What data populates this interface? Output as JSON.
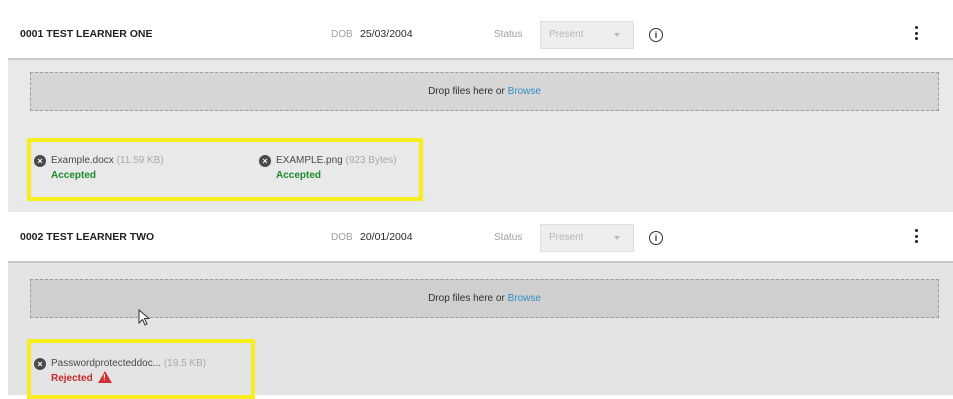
{
  "learners": [
    {
      "name": "0001 TEST LEARNER ONE",
      "dob_label": "DOB",
      "dob": "25/03/2004",
      "status_label": "Status",
      "status": "Present",
      "dropzone": {
        "text": "Drop files here or",
        "link": "Browse"
      },
      "files": [
        {
          "name": "Example.docx",
          "size": "(11.59 KB)",
          "status": "Accepted"
        },
        {
          "name": "EXAMPLE.png",
          "size": "(923 Bytes)",
          "status": "Accepted"
        }
      ]
    },
    {
      "name": "0002 TEST LEARNER TWO",
      "dob_label": "DOB",
      "dob": "20/01/2004",
      "status_label": "Status",
      "status": "Present",
      "dropzone": {
        "text": "Drop files here or",
        "link": "Browse"
      },
      "files": [
        {
          "name": "Passwordprotecteddoc...",
          "size": "(19.5 KB)",
          "status": "Rejected"
        }
      ]
    }
  ],
  "colors": {
    "accepted": "#1e8a2e",
    "rejected": "#c62828",
    "highlight": "#f6ee1d",
    "browse_link": "#2f8fc6"
  },
  "icons": [
    "remove-file-icon",
    "info-icon",
    "more-options-icon",
    "warning-icon",
    "chevron-down-icon",
    "mouse-cursor-icon"
  ]
}
